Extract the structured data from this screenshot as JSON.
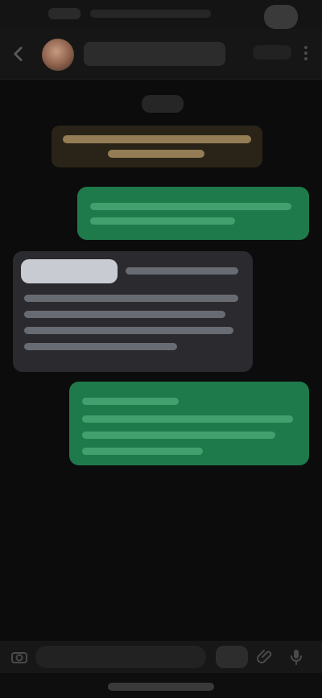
{
  "app": {
    "name": "",
    "colors": {
      "background": "#0c0c0c",
      "header": "#161616",
      "outgoing_bubble": "#1f7a4b",
      "incoming_bubble": "#2b2b2f",
      "system_notice": "#2a2418"
    }
  },
  "header": {
    "contact_name": "",
    "icons": {
      "back": "back-arrow-icon",
      "more": "more-vertical-icon"
    }
  },
  "conversation": {
    "date_label": "",
    "system_notice": "",
    "messages": [
      {
        "direction": "outgoing",
        "text": ""
      },
      {
        "direction": "incoming",
        "text": ""
      },
      {
        "direction": "outgoing",
        "text": ""
      }
    ]
  },
  "composer": {
    "placeholder": "",
    "icons": {
      "left": "camera-icon",
      "emoji": "emoji-icon",
      "attach": "attach-icon",
      "send": "mic-icon"
    }
  }
}
